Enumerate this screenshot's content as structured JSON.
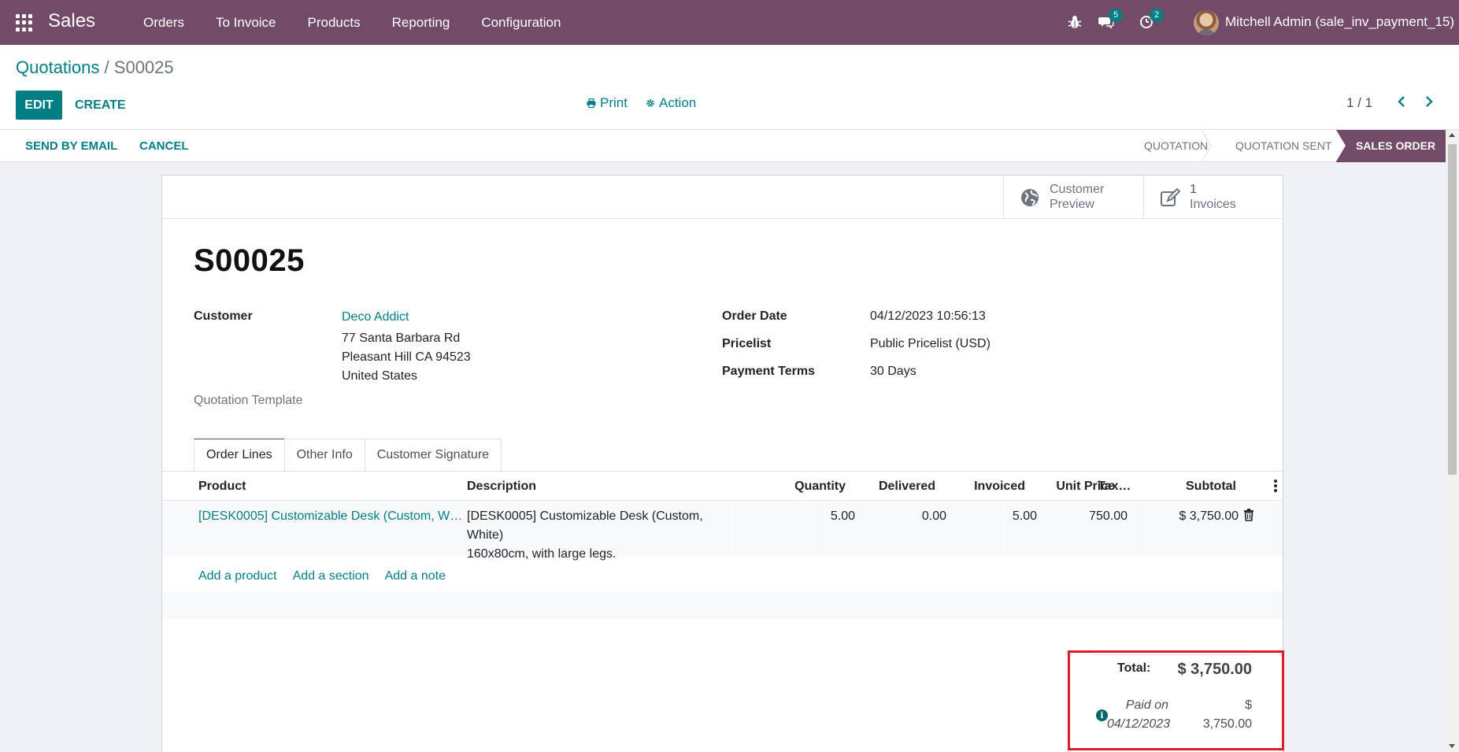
{
  "navbar": {
    "app_name": "Sales",
    "menu": [
      "Orders",
      "To Invoice",
      "Products",
      "Reporting",
      "Configuration"
    ],
    "messages_count": "5",
    "activities_count": "2",
    "user_name": "Mitchell Admin (sale_inv_payment_15)"
  },
  "breadcrumb": {
    "parent": "Quotations",
    "separator": "/",
    "current": "S00025"
  },
  "toolbar": {
    "edit_label": "EDIT",
    "create_label": "CREATE",
    "print_label": "Print",
    "action_label": "Action",
    "pager": "1 / 1"
  },
  "statusbar": {
    "send_email_label": "SEND BY EMAIL",
    "cancel_label": "CANCEL",
    "stages": [
      "QUOTATION",
      "QUOTATION SENT",
      "SALES ORDER"
    ]
  },
  "smart_buttons": {
    "preview_line1": "Customer",
    "preview_line2": "Preview",
    "invoices_count": "1",
    "invoices_label": "Invoices"
  },
  "record": {
    "name": "S00025",
    "customer_label": "Customer",
    "customer_name": "Deco Addict",
    "address_line1": "77 Santa Barbara Rd",
    "address_line2": "Pleasant Hill CA 94523",
    "address_line3": "United States",
    "template_label": "Quotation Template",
    "order_date_label": "Order Date",
    "order_date": "04/12/2023 10:56:13",
    "pricelist_label": "Pricelist",
    "pricelist": "Public Pricelist (USD)",
    "payment_terms_label": "Payment Terms",
    "payment_terms": "30 Days"
  },
  "tabs": [
    "Order Lines",
    "Other Info",
    "Customer Signature"
  ],
  "table": {
    "headers": [
      "Product",
      "Description",
      "Quantity",
      "Delivered",
      "Invoiced",
      "Unit Price",
      "Tax…",
      "Subtotal"
    ],
    "rows": [
      {
        "product": "[DESK0005] Customizable Desk (Custom, W…",
        "description_line1": "[DESK0005] Customizable Desk (Custom,",
        "description_line2": "White)",
        "description_line3": "160x80cm, with large legs.",
        "quantity": "5.00",
        "delivered": "0.00",
        "invoiced": "5.00",
        "unit_price": "750.00",
        "taxes": "",
        "subtotal": "$ 3,750.00"
      }
    ],
    "add_product": "Add a product",
    "add_section": "Add a section",
    "add_note": "Add a note"
  },
  "totals": {
    "total_label": "Total:",
    "total_value": "$ 3,750.00",
    "paid_on_line1": "Paid on",
    "paid_on_line2": "04/12/2023",
    "paid_amount_line1": "$",
    "paid_amount_line2": "3,750.00"
  },
  "colors": {
    "brand": "#714b67",
    "link": "#017e84",
    "highlight": "#e01b2b"
  }
}
